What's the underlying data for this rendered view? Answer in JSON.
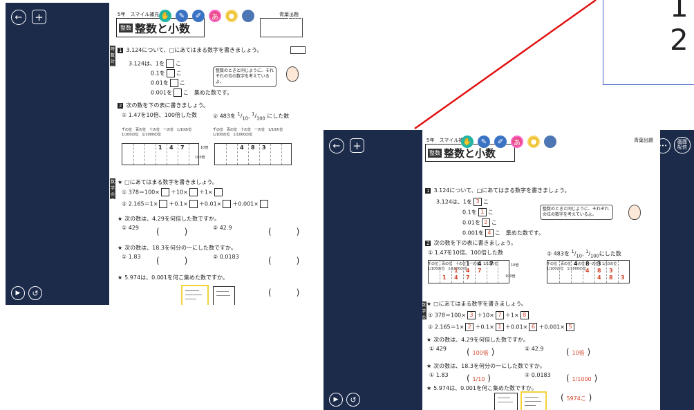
{
  "zoom": {
    "line1": "1",
    "line2": "2"
  },
  "common": {
    "back_glyph": "←",
    "add_glyph": "+",
    "more_glyph": "•••",
    "screen_delivery_label": "画面\n配信",
    "play_glyph": "▶",
    "reset_glyph": "↺",
    "grade_series": "5年　スマイル補充",
    "status_label": "青葉出題",
    "title_icon": "整数",
    "title": "整数と小数",
    "toolbar": [
      "hand-icon",
      "pen-icon",
      "marker-icon",
      "hiragana-icon",
      "mic-icon",
      "more-tool-icon"
    ],
    "hiragana": "あ"
  },
  "sheet": {
    "side_tag_1": "時数 計算練習",
    "side_tag_2": "数学の準備",
    "q1": {
      "num": "1",
      "text": "3.124について、□にあてはまる数字を書きましょう。",
      "lines": [
        {
          "prefix": "3.124は、1を",
          "suffix": "こ"
        },
        {
          "prefix": "0.1を",
          "suffix": "こ"
        },
        {
          "prefix": "0.01を",
          "suffix": "こ"
        },
        {
          "prefix": "0.001を",
          "suffix": "こ　集めた数です。"
        }
      ],
      "note": "整数のときと同じように、それぞれの位の数字を考えているよ。"
    },
    "q2": {
      "num": "2",
      "text": "次の数を下の表に書きましょう。",
      "sub1": "① 1.47を10倍、100倍した数",
      "sub2_a": "② 483を",
      "sub2_b": "にした数",
      "frac_top": "1",
      "frac_bot_10": "10",
      "frac_bot_100": "100",
      "place_headers": "千の位　百の位　十の位　一の位　1/10の位　1/100の位　1/1000の位",
      "digits_left": [
        "1",
        "4",
        "7"
      ],
      "digits_right": [
        "4",
        "8",
        "3"
      ],
      "arrow_10": "10倍",
      "arrow_100": "100倍"
    },
    "s1": {
      "text": "□にあてはまる数字を書きましょう。",
      "eq1_parts": [
        "① 378＝100×",
        "＋10×",
        "＋1×"
      ],
      "eq2_parts": [
        "② 2.165＝1×",
        "＋0.1×",
        "＋0.01×",
        "＋0.001×"
      ]
    },
    "s2": {
      "text": "次の数は、4.29を何倍した数ですか。",
      "a": "① 429",
      "b": "② 42.9"
    },
    "s3": {
      "text": "次の数は、18.3を何分の一にした数ですか。",
      "a": "① 1.83",
      "b": "② 0.0183"
    },
    "s4": {
      "text": "5.974は、0.001を何こ集めた数ですか。"
    },
    "answers": {
      "q1": [
        "3",
        "1",
        "2",
        "4"
      ],
      "s1_eq1": [
        "3",
        "7",
        "8"
      ],
      "s1_eq2": [
        "2",
        "1",
        "6",
        "5"
      ],
      "s2_a": "100倍",
      "s2_b": "10倍",
      "s3_a": "1/10",
      "s3_b": "1/1000",
      "s4": "5974こ"
    }
  },
  "colors": {
    "viewer_bg": "#1d2b4b",
    "answer": "#d2452a",
    "zoom_border": "#3957c8",
    "connector": "#e01010"
  }
}
